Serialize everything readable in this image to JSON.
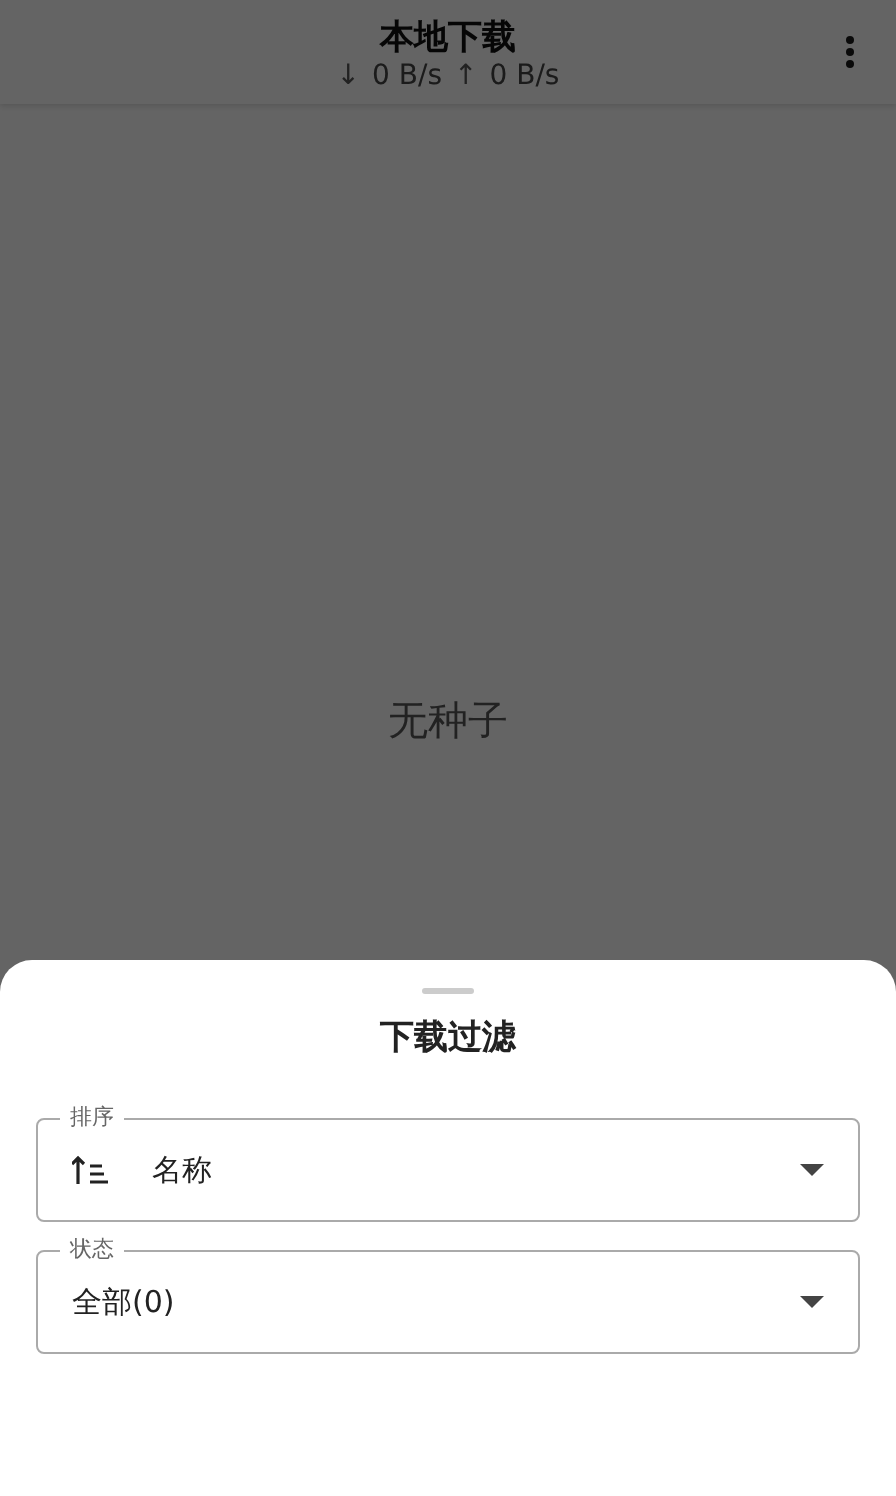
{
  "app_bar": {
    "title": "本地下载",
    "speeds": [
      {
        "arrow": "↓",
        "value": "0 B/s"
      },
      {
        "arrow": "↑",
        "value": "0 B/s"
      }
    ]
  },
  "empty_message": "无种子",
  "sheet": {
    "title": "下载过滤",
    "fields": [
      {
        "kind": "sort",
        "label": "排序",
        "value": "名称"
      },
      {
        "kind": "plain",
        "label": "状态",
        "value": "全部(0)"
      }
    ]
  }
}
